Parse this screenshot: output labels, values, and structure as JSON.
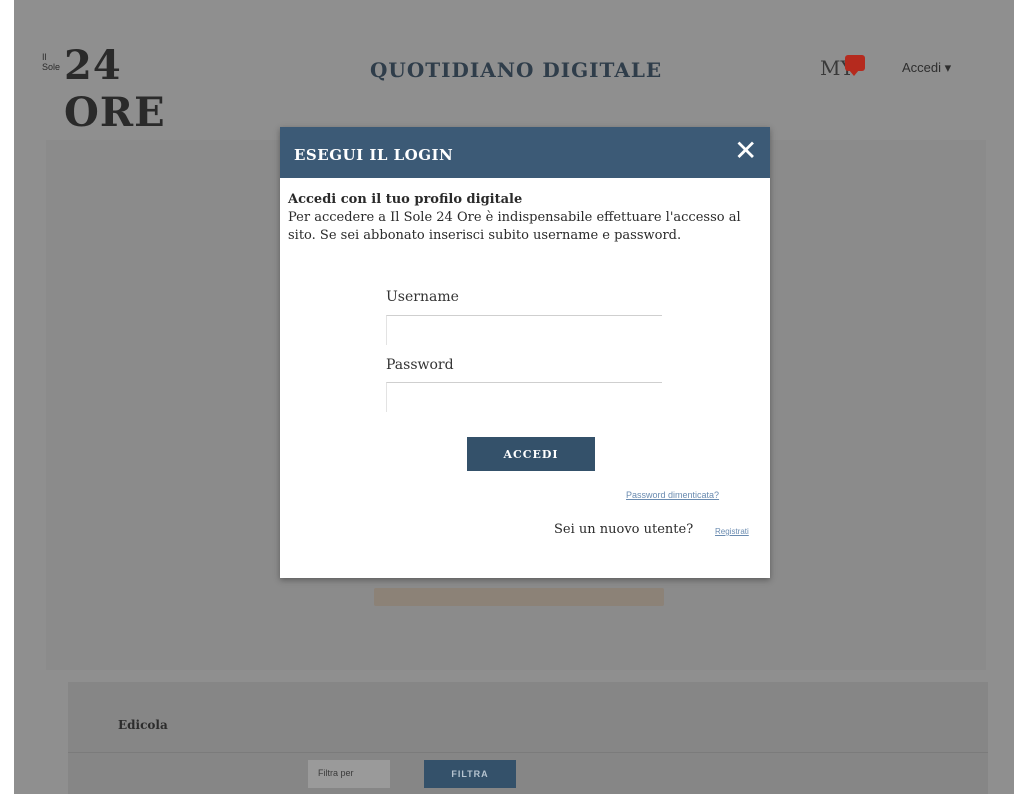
{
  "header": {
    "logo_small": "Il Sole",
    "logo_big": "24 ORE",
    "masthead": "QUOTIDIANO DIGITALE",
    "my_label": "MY",
    "my_icon": "speech-bubble-icon",
    "nav_accedi": "Accedi ▾"
  },
  "modal": {
    "title": "ESEGUI IL LOGIN",
    "close_icon": "close-icon",
    "intro_heading": "Accedi con il tuo profilo digitale",
    "intro_text": "Per accedere a Il Sole 24 Ore è indispensabile effettuare l'accesso al sito. Se sei abbonato inserisci subito username e password.",
    "username_label": "Username",
    "username_value": "",
    "password_label": "Password",
    "password_value": "",
    "submit_label": "ACCEDI",
    "forgot_link": "Password dimenticata?",
    "new_user_text": "Sei un nuovo utente?",
    "register_link": "Registrati"
  },
  "edicola": {
    "title": "Edicola",
    "filter_label": "Filtra per",
    "filter_button": "FILTRA"
  },
  "colors": {
    "modal_header": "#3c5a76",
    "primary_button": "#34516a",
    "overlay": "#8f8f8f",
    "my_icon": "#b52a1e"
  }
}
